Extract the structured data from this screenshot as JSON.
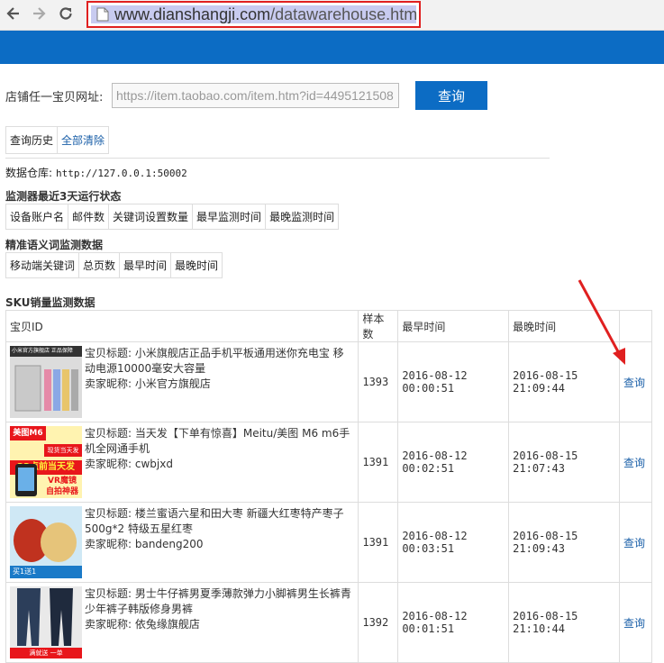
{
  "browser": {
    "url_host": "www.dianshangji.com",
    "url_path": "/datawarehouse.htm"
  },
  "search": {
    "label": "店铺任一宝贝网址:",
    "value": "https://item.taobao.com/item.htm?id=4495121508",
    "button": "查询"
  },
  "history": {
    "label": "查询历史",
    "clear": "全部清除"
  },
  "warehouse": {
    "label": "数据仓库:",
    "value": "http://127.0.0.1:50002"
  },
  "monitor": {
    "title": "监测器最近3天运行状态",
    "columns": [
      "设备账户名",
      "邮件数",
      "关键词设置数量",
      "最早监测时间",
      "最晚监测时间"
    ]
  },
  "semantic": {
    "title": "精准语义词监测数据",
    "columns": [
      "移动端关键词",
      "总页数",
      "最早时间",
      "最晚时间"
    ]
  },
  "sku": {
    "title": "SKU销量监测数据",
    "columns": [
      "宝贝ID",
      "样本数",
      "最早时间",
      "最晚时间",
      ""
    ],
    "rows": [
      {
        "title": "宝贝标题: 小米旗舰店正品手机平板通用迷你充电宝 移动电源10000毫安大容量",
        "seller": "卖家昵称: 小米官方旗舰店",
        "samples": "1393",
        "earliest": "2016-08-12 00:00:51",
        "latest": "2016-08-15 21:09:44",
        "action": "查询"
      },
      {
        "title": "宝贝标题: 当天发【下单有惊喜】Meitu/美图 M6 m6手机全网通手机",
        "seller": "卖家昵称: cwbjxd",
        "samples": "1391",
        "earliest": "2016-08-12 00:02:51",
        "latest": "2016-08-15 21:07:43",
        "action": "查询"
      },
      {
        "title": "宝贝标题: 楼兰蜜语六星和田大枣 新疆大红枣特产枣子500g*2 特级五星红枣",
        "seller": "卖家昵称: bandeng200",
        "samples": "1391",
        "earliest": "2016-08-12 00:03:51",
        "latest": "2016-08-15 21:09:43",
        "action": "查询"
      },
      {
        "title": "宝贝标题: 男士牛仔裤男夏季薄款弹力小脚裤男生长裤青少年裤子韩版修身男裤",
        "seller": "卖家昵称: 依兔缘旗舰店",
        "samples": "1392",
        "earliest": "2016-08-12 00:01:51",
        "latest": "2016-08-15 21:10:44",
        "action": "查询"
      }
    ]
  },
  "thumbs": {
    "t1": "小米官方旗舰店 正品保障",
    "t2a": "美图M6",
    "t2b": "现货当天发",
    "t2c": "23点前当天发",
    "t2d": "VR魔镜",
    "t2e": "自拍神器",
    "t3": "买1送1",
    "t4": "满就送 一单"
  },
  "colors": {
    "banner": "#0c6cc4",
    "link": "#1a5fa8",
    "highlight": "#e02020"
  }
}
